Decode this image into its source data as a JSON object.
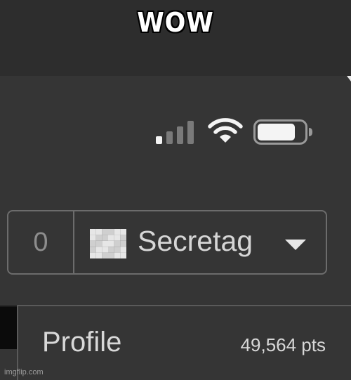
{
  "meme": {
    "caption": "WOW"
  },
  "status_bar": {
    "signal_icon": "cellular-signal-icon",
    "signal_bars_active": 1,
    "signal_bars_total": 4,
    "wifi_icon": "wifi-icon",
    "battery_icon": "battery-icon",
    "battery_level_percent": 80
  },
  "tag_selector": {
    "count": "0",
    "avatar_icon": "checkered-avatar-icon",
    "name": "Secretag",
    "caret_icon": "dropdown-caret-icon"
  },
  "profile": {
    "label": "Profile",
    "points": "49,564 pts"
  },
  "watermark": "imgflip.com",
  "colors": {
    "background": "#353535",
    "text": "#d8d8d8",
    "border": "#6c6c6c"
  }
}
